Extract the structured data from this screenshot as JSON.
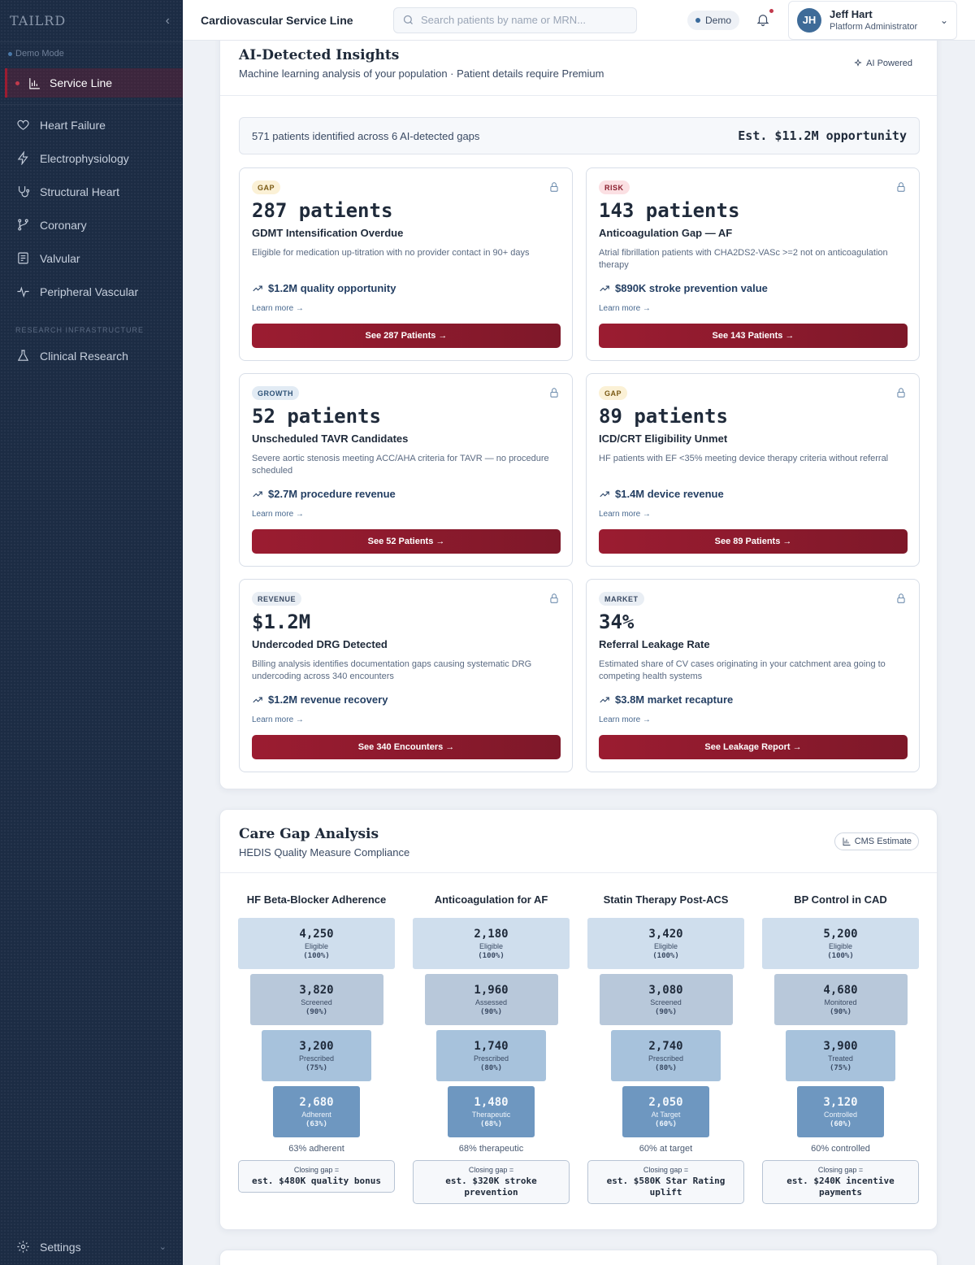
{
  "sidebar": {
    "logo": "TAILRD",
    "demo_mode": "Demo Mode",
    "active_item": "Service Line",
    "items": [
      {
        "label": "Heart Failure",
        "icon": "heart-icon"
      },
      {
        "label": "Electrophysiology",
        "icon": "bolt-icon"
      },
      {
        "label": "Structural Heart",
        "icon": "stethoscope-icon"
      },
      {
        "label": "Coronary",
        "icon": "branch-icon"
      },
      {
        "label": "Valvular",
        "icon": "valve-icon"
      },
      {
        "label": "Peripheral Vascular",
        "icon": "pulse-icon"
      }
    ],
    "research_header": "RESEARCH INFRASTRUCTURE",
    "research_item": "Clinical Research",
    "settings": "Settings"
  },
  "topbar": {
    "title": "Cardiovascular Service Line",
    "search_placeholder": "Search patients by name or MRN...",
    "demo_badge": "Demo",
    "user_initials": "JH",
    "user_name": "Jeff Hart",
    "user_role": "Platform Administrator"
  },
  "insights": {
    "title": "AI-Detected Insights",
    "subtitle": "Machine learning analysis of your population · Patient details require Premium",
    "chip": "AI Powered",
    "summary_text": "571 patients identified across 6 AI-detected gaps",
    "summary_value": "Est. $11.2M opportunity",
    "cards": [
      {
        "tag": "GAP",
        "big": "287 patients",
        "title": "GDMT Intensification Overdue",
        "desc": "Eligible for medication up-titration with no provider contact in 90+ days",
        "value": "$1.2M quality opportunity",
        "learn": "Learn more →",
        "button": "See 287 Patients →"
      },
      {
        "tag": "RISK",
        "big": "143 patients",
        "title": "Anticoagulation Gap — AF",
        "desc": "Atrial fibrillation patients with CHA2DS2-VASc >=2 not on anticoagulation therapy",
        "value": "$890K stroke prevention value",
        "learn": "Learn more →",
        "button": "See 143 Patients →"
      },
      {
        "tag": "GROWTH",
        "big": "52 patients",
        "title": "Unscheduled TAVR Candidates",
        "desc": "Severe aortic stenosis meeting ACC/AHA criteria for TAVR — no procedure scheduled",
        "value": "$2.7M procedure revenue",
        "learn": "Learn more →",
        "button": "See 52 Patients →"
      },
      {
        "tag": "GAP",
        "big": "89 patients",
        "title": "ICD/CRT Eligibility Unmet",
        "desc": "HF patients with EF <35% meeting device therapy criteria without referral",
        "value": "$1.4M device revenue",
        "learn": "Learn more →",
        "button": "See 89 Patients →"
      },
      {
        "tag": "REVENUE",
        "big": "$1.2M",
        "title": "Undercoded DRG Detected",
        "desc": "Billing analysis identifies documentation gaps causing systematic DRG undercoding across 340 encounters",
        "value": "$1.2M revenue recovery",
        "learn": "Learn more →",
        "button": "See 340 Encounters →"
      },
      {
        "tag": "MARKET",
        "big": "34%",
        "title": "Referral Leakage Rate",
        "desc": "Estimated share of CV cases originating in your catchment area going to competing health systems",
        "value": "$3.8M market recapture",
        "learn": "Learn more →",
        "button": "See Leakage Report →"
      }
    ]
  },
  "care_gap": {
    "title": "Care Gap Analysis",
    "subtitle": "HEDIS Quality Measure Compliance",
    "chip": "CMS Estimate",
    "columns": [
      {
        "title": "HF Beta-Blocker Adherence",
        "steps": [
          [
            "4,250",
            "Eligible",
            "(100%)"
          ],
          [
            "3,820",
            "Screened",
            "(90%)"
          ],
          [
            "3,200",
            "Prescribed",
            "(75%)"
          ],
          [
            "2,680",
            "Adherent",
            "(63%)"
          ]
        ],
        "footer": "63% adherent",
        "closing_label": "Closing gap =",
        "closing_value": "est. $480K quality bonus"
      },
      {
        "title": "Anticoagulation for AF",
        "steps": [
          [
            "2,180",
            "Eligible",
            "(100%)"
          ],
          [
            "1,960",
            "Assessed",
            "(90%)"
          ],
          [
            "1,740",
            "Prescribed",
            "(80%)"
          ],
          [
            "1,480",
            "Therapeutic",
            "(68%)"
          ]
        ],
        "footer": "68% therapeutic",
        "closing_label": "Closing gap =",
        "closing_value": "est. $320K stroke prevention"
      },
      {
        "title": "Statin Therapy Post-ACS",
        "steps": [
          [
            "3,420",
            "Eligible",
            "(100%)"
          ],
          [
            "3,080",
            "Screened",
            "(90%)"
          ],
          [
            "2,740",
            "Prescribed",
            "(80%)"
          ],
          [
            "2,050",
            "At Target",
            "(60%)"
          ]
        ],
        "footer": "60% at target",
        "closing_label": "Closing gap =",
        "closing_value": "est. $580K Star Rating uplift"
      },
      {
        "title": "BP Control in CAD",
        "steps": [
          [
            "5,200",
            "Eligible",
            "(100%)"
          ],
          [
            "4,680",
            "Monitored",
            "(90%)"
          ],
          [
            "3,900",
            "Treated",
            "(75%)"
          ],
          [
            "3,120",
            "Controlled",
            "(60%)"
          ]
        ],
        "footer": "60% controlled",
        "closing_label": "Closing gap =",
        "closing_value": "est. $240K incentive payments"
      }
    ]
  }
}
